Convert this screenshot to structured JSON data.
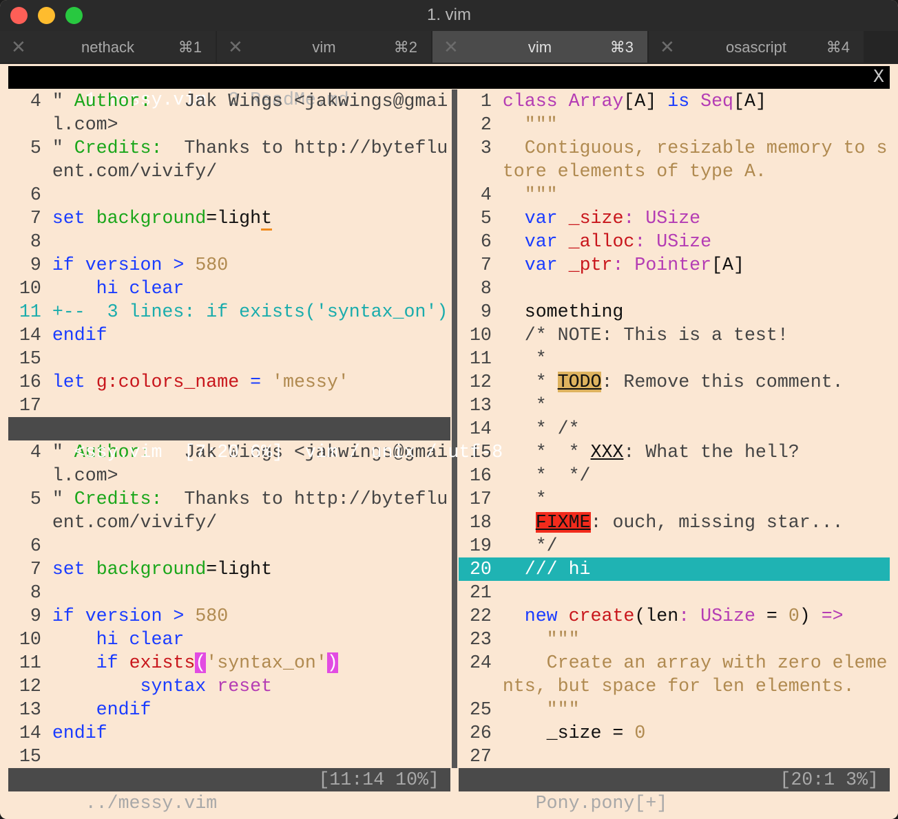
{
  "window": {
    "title": "1. vim"
  },
  "tabs": [
    {
      "label": "nethack",
      "shortcut": "⌘1",
      "active": false
    },
    {
      "label": "vim",
      "shortcut": "⌘2",
      "active": false
    },
    {
      "label": "vim",
      "shortcut": "⌘3",
      "active": true
    },
    {
      "label": "osascript",
      "shortcut": "⌘4",
      "active": false
    }
  ],
  "vim_tabline": {
    "selected": " 1 messy.vim ",
    "other": " 2 ReadMe.md",
    "close": "X"
  },
  "colors": {
    "background": "#fbe7d3",
    "cursorline": "#1fb3b3",
    "statusline": "#4a4a4a",
    "todo": "#deb35f",
    "fixme": "#f22b1c",
    "matchparen": "#e24ce2"
  },
  "panes": {
    "left_top": {
      "lines": [
        {
          "num": "4",
          "tokens": [
            [
              "\" ",
              "plain"
            ],
            [
              "Author:",
              "green"
            ],
            [
              "   Jak Wings <jakwings@gmai",
              "plain"
            ]
          ]
        },
        {
          "num": "",
          "tokens": [
            [
              "l.com>",
              "plain"
            ]
          ]
        },
        {
          "num": "5",
          "tokens": [
            [
              "\" ",
              "plain"
            ],
            [
              "Credits:",
              "green"
            ],
            [
              "  Thanks to http://byteflu",
              "plain"
            ]
          ]
        },
        {
          "num": "",
          "tokens": [
            [
              "ent.com/vivify/",
              "plain"
            ]
          ]
        },
        {
          "num": "6",
          "tokens": []
        },
        {
          "num": "7",
          "tokens": [
            [
              "set",
              "blue"
            ],
            [
              " ",
              "plain"
            ],
            [
              "background",
              "green"
            ],
            [
              "=ligh",
              "black"
            ],
            [
              "t",
              "cursor"
            ]
          ]
        },
        {
          "num": "8",
          "tokens": []
        },
        {
          "num": "9",
          "tokens": [
            [
              "if version > ",
              "blue"
            ],
            [
              "580",
              "tan"
            ]
          ]
        },
        {
          "num": "10",
          "tokens": [
            [
              "    hi clear",
              "blue"
            ]
          ]
        },
        {
          "num": "11",
          "fold": true,
          "tokens": [
            [
              "+--  3 lines: if exists('syntax_on')",
              "fold"
            ]
          ]
        },
        {
          "num": "14",
          "tokens": [
            [
              "endif",
              "blue"
            ]
          ]
        },
        {
          "num": "15",
          "tokens": []
        },
        {
          "num": "16",
          "tokens": [
            [
              "let ",
              "blue"
            ],
            [
              "g:colors_name",
              "red"
            ],
            [
              " = ",
              "blue"
            ],
            [
              "'messy'",
              "tan"
            ]
          ]
        },
        {
          "num": "17",
          "tokens": []
        }
      ],
      "status": {
        "left": "<ssy.vim  [7:20 6%]  vim / unix / utf-8",
        "right": ""
      }
    },
    "left_bottom": {
      "lines": [
        {
          "num": "4",
          "tokens": [
            [
              "\" ",
              "plain"
            ],
            [
              "Author:",
              "green"
            ],
            [
              "   Jak Wings <jakwings@gmai",
              "plain"
            ]
          ]
        },
        {
          "num": "",
          "tokens": [
            [
              "l.com>",
              "plain"
            ]
          ]
        },
        {
          "num": "5",
          "tokens": [
            [
              "\" ",
              "plain"
            ],
            [
              "Credits:",
              "green"
            ],
            [
              "  Thanks to http://byteflu",
              "plain"
            ]
          ]
        },
        {
          "num": "",
          "tokens": [
            [
              "ent.com/vivify/",
              "plain"
            ]
          ]
        },
        {
          "num": "6",
          "tokens": []
        },
        {
          "num": "7",
          "tokens": [
            [
              "set",
              "blue"
            ],
            [
              " ",
              "plain"
            ],
            [
              "background",
              "green"
            ],
            [
              "=light",
              "black"
            ]
          ]
        },
        {
          "num": "8",
          "tokens": []
        },
        {
          "num": "9",
          "tokens": [
            [
              "if version > ",
              "blue"
            ],
            [
              "580",
              "tan"
            ]
          ]
        },
        {
          "num": "10",
          "tokens": [
            [
              "    hi clear",
              "blue"
            ]
          ]
        },
        {
          "num": "11",
          "tokens": [
            [
              "    if ",
              "blue"
            ],
            [
              "exists",
              "red"
            ],
            [
              "(",
              "paren"
            ],
            [
              "'syntax_on'",
              "tan"
            ],
            [
              ")",
              "paren"
            ]
          ]
        },
        {
          "num": "12",
          "tokens": [
            [
              "        syntax ",
              "blue"
            ],
            [
              "reset",
              "purple"
            ]
          ]
        },
        {
          "num": "13",
          "tokens": [
            [
              "    endif",
              "blue"
            ]
          ]
        },
        {
          "num": "14",
          "tokens": [
            [
              "endif",
              "blue"
            ]
          ]
        },
        {
          "num": "15",
          "tokens": []
        }
      ],
      "status": {
        "left": " ../messy.vim",
        "right": "[11:14 10%]"
      }
    },
    "right": {
      "lines": [
        {
          "num": "1",
          "tokens": [
            [
              "class Array",
              "purple"
            ],
            [
              "[A] ",
              "black"
            ],
            [
              "is ",
              "blue"
            ],
            [
              "Seq",
              "purple"
            ],
            [
              "[A]",
              "black"
            ]
          ]
        },
        {
          "num": "2",
          "tokens": [
            [
              "  \"\"\"",
              "tan"
            ]
          ]
        },
        {
          "num": "3",
          "tokens": [
            [
              "  Contiguous, resizable memory to s",
              "tan"
            ]
          ]
        },
        {
          "num": "",
          "tokens": [
            [
              "tore elements of type A.",
              "tan"
            ]
          ]
        },
        {
          "num": "4",
          "tokens": [
            [
              "  \"\"\"",
              "tan"
            ]
          ]
        },
        {
          "num": "5",
          "tokens": [
            [
              "  var ",
              "blue"
            ],
            [
              "_size",
              "red"
            ],
            [
              ": USize",
              "purple"
            ]
          ]
        },
        {
          "num": "6",
          "tokens": [
            [
              "  var ",
              "blue"
            ],
            [
              "_alloc",
              "red"
            ],
            [
              ": USize",
              "purple"
            ]
          ]
        },
        {
          "num": "7",
          "tokens": [
            [
              "  var ",
              "blue"
            ],
            [
              "_ptr",
              "red"
            ],
            [
              ": Pointer",
              "purple"
            ],
            [
              "[A]",
              "black"
            ]
          ]
        },
        {
          "num": "8",
          "tokens": []
        },
        {
          "num": "9",
          "tokens": [
            [
              "  something",
              "black"
            ]
          ]
        },
        {
          "num": "10",
          "tokens": [
            [
              "  /* NOTE: This is a test!",
              "plain"
            ]
          ]
        },
        {
          "num": "11",
          "tokens": [
            [
              "   *",
              "plain"
            ]
          ]
        },
        {
          "num": "12",
          "tokens": [
            [
              "   * ",
              "plain"
            ],
            [
              "TODO",
              "todo"
            ],
            [
              ": Remove this comment.",
              "plain"
            ]
          ]
        },
        {
          "num": "13",
          "tokens": [
            [
              "   *",
              "plain"
            ]
          ]
        },
        {
          "num": "14",
          "tokens": [
            [
              "   * /*",
              "plain"
            ]
          ]
        },
        {
          "num": "15",
          "tokens": [
            [
              "   *  * ",
              "plain"
            ],
            [
              "XXX",
              "xxx"
            ],
            [
              ": What the hell?",
              "plain"
            ]
          ]
        },
        {
          "num": "16",
          "tokens": [
            [
              "   *  */",
              "plain"
            ]
          ]
        },
        {
          "num": "17",
          "tokens": [
            [
              "   *",
              "plain"
            ]
          ]
        },
        {
          "num": "18",
          "tokens": [
            [
              "   ",
              "plain"
            ],
            [
              "FIXME",
              "fixme"
            ],
            [
              ": ouch, missing star...",
              "plain"
            ]
          ]
        },
        {
          "num": "19",
          "tokens": [
            [
              "   */",
              "plain"
            ]
          ]
        },
        {
          "num": "20",
          "current": true,
          "tokens": [
            [
              "  /// hi",
              "plain"
            ]
          ]
        },
        {
          "num": "21",
          "tokens": []
        },
        {
          "num": "22",
          "tokens": [
            [
              "  new ",
              "blue"
            ],
            [
              "create",
              "red"
            ],
            [
              "(len",
              "black"
            ],
            [
              ": USize",
              "purple"
            ],
            [
              " = ",
              "black"
            ],
            [
              "0",
              "tan"
            ],
            [
              ") ",
              "black"
            ],
            [
              "=>",
              "purple"
            ]
          ]
        },
        {
          "num": "23",
          "tokens": [
            [
              "    \"\"\"",
              "tan"
            ]
          ]
        },
        {
          "num": "24",
          "tokens": [
            [
              "    Create an array with zero eleme",
              "tan"
            ]
          ]
        },
        {
          "num": "",
          "tokens": [
            [
              "nts, but space for len elements.",
              "tan"
            ]
          ]
        },
        {
          "num": "25",
          "tokens": [
            [
              "    \"\"\"",
              "tan"
            ]
          ]
        },
        {
          "num": "26",
          "tokens": [
            [
              "    _size = ",
              "black"
            ],
            [
              "0",
              "tan"
            ]
          ]
        },
        {
          "num": "27",
          "tokens": []
        }
      ],
      "status": {
        "left": " Pony.pony[+]",
        "right": "[20:1 3%]"
      }
    }
  }
}
